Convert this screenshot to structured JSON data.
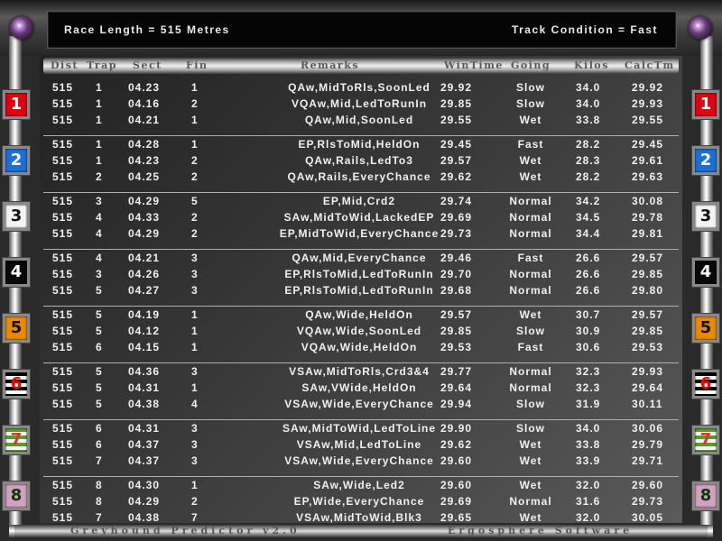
{
  "info": {
    "race_length": "Race Length = 515 Metres",
    "track_condition": "Track Condition = Fast"
  },
  "headers": {
    "dist": "Dist",
    "trap": "Trap",
    "sect": "Sect",
    "fin": "Fin",
    "remarks": "Remarks",
    "wintime": "WinTime",
    "going": "Going",
    "kilos": "Kilos",
    "calctm": "CalcTm"
  },
  "traps": [
    {
      "number": "1",
      "color": "#e00010"
    },
    {
      "number": "2",
      "color": "#1a70d8"
    },
    {
      "number": "3",
      "color": "#f4f4f4"
    },
    {
      "number": "4",
      "color": "#080808"
    },
    {
      "number": "5",
      "color": "#e88a00"
    },
    {
      "number": "6",
      "color": "#000000"
    },
    {
      "number": "7",
      "color": "#5a9a30"
    },
    {
      "number": "8",
      "color": "#d4a0c0"
    }
  ],
  "groups": [
    {
      "rows": [
        {
          "dist": "515",
          "trap": "1",
          "sect": "04.23",
          "fin": "1",
          "remarks": "QAw,MidToRls,SoonLed",
          "wintime": "29.92",
          "going": "Slow",
          "kilos": "34.0",
          "calctm": "29.92"
        },
        {
          "dist": "515",
          "trap": "1",
          "sect": "04.16",
          "fin": "2",
          "remarks": "VQAw,Mid,LedToRunIn",
          "wintime": "29.85",
          "going": "Slow",
          "kilos": "34.0",
          "calctm": "29.93"
        },
        {
          "dist": "515",
          "trap": "1",
          "sect": "04.21",
          "fin": "1",
          "remarks": "QAw,Mid,SoonLed",
          "wintime": "29.55",
          "going": "Wet",
          "kilos": "33.8",
          "calctm": "29.55"
        }
      ]
    },
    {
      "rows": [
        {
          "dist": "515",
          "trap": "1",
          "sect": "04.28",
          "fin": "1",
          "remarks": "EP,RlsToMid,HeldOn",
          "wintime": "29.45",
          "going": "Fast",
          "kilos": "28.2",
          "calctm": "29.45"
        },
        {
          "dist": "515",
          "trap": "1",
          "sect": "04.23",
          "fin": "2",
          "remarks": "QAw,Rails,LedTo3",
          "wintime": "29.57",
          "going": "Wet",
          "kilos": "28.3",
          "calctm": "29.61"
        },
        {
          "dist": "515",
          "trap": "2",
          "sect": "04.25",
          "fin": "2",
          "remarks": "QAw,Rails,EveryChance",
          "wintime": "29.62",
          "going": "Wet",
          "kilos": "28.2",
          "calctm": "29.63"
        }
      ]
    },
    {
      "rows": [
        {
          "dist": "515",
          "trap": "3",
          "sect": "04.29",
          "fin": "5",
          "remarks": "EP,Mid,Crd2",
          "wintime": "29.74",
          "going": "Normal",
          "kilos": "34.2",
          "calctm": "30.08"
        },
        {
          "dist": "515",
          "trap": "4",
          "sect": "04.33",
          "fin": "2",
          "remarks": "SAw,MidToWid,LackedEP",
          "wintime": "29.69",
          "going": "Normal",
          "kilos": "34.5",
          "calctm": "29.78"
        },
        {
          "dist": "515",
          "trap": "4",
          "sect": "04.29",
          "fin": "2",
          "remarks": "EP,MidToWid,EveryChance",
          "wintime": "29.73",
          "going": "Normal",
          "kilos": "34.4",
          "calctm": "29.81"
        }
      ]
    },
    {
      "rows": [
        {
          "dist": "515",
          "trap": "4",
          "sect": "04.21",
          "fin": "3",
          "remarks": "QAw,Mid,EveryChance",
          "wintime": "29.46",
          "going": "Fast",
          "kilos": "26.6",
          "calctm": "29.57"
        },
        {
          "dist": "515",
          "trap": "3",
          "sect": "04.26",
          "fin": "3",
          "remarks": "EP,RlsToMid,LedToRunIn",
          "wintime": "29.70",
          "going": "Normal",
          "kilos": "26.6",
          "calctm": "29.85"
        },
        {
          "dist": "515",
          "trap": "5",
          "sect": "04.27",
          "fin": "3",
          "remarks": "EP,RlsToMid,LedToRunIn",
          "wintime": "29.68",
          "going": "Normal",
          "kilos": "26.6",
          "calctm": "29.80"
        }
      ]
    },
    {
      "rows": [
        {
          "dist": "515",
          "trap": "5",
          "sect": "04.19",
          "fin": "1",
          "remarks": "QAw,Wide,HeldOn",
          "wintime": "29.57",
          "going": "Wet",
          "kilos": "30.7",
          "calctm": "29.57"
        },
        {
          "dist": "515",
          "trap": "5",
          "sect": "04.12",
          "fin": "1",
          "remarks": "VQAw,Wide,SoonLed",
          "wintime": "29.85",
          "going": "Slow",
          "kilos": "30.9",
          "calctm": "29.85"
        },
        {
          "dist": "515",
          "trap": "6",
          "sect": "04.15",
          "fin": "1",
          "remarks": "VQAw,Wide,HeldOn",
          "wintime": "29.53",
          "going": "Fast",
          "kilos": "30.6",
          "calctm": "29.53"
        }
      ]
    },
    {
      "rows": [
        {
          "dist": "515",
          "trap": "5",
          "sect": "04.36",
          "fin": "3",
          "remarks": "VSAw,MidToRls,Crd3&4",
          "wintime": "29.77",
          "going": "Normal",
          "kilos": "32.3",
          "calctm": "29.93"
        },
        {
          "dist": "515",
          "trap": "5",
          "sect": "04.31",
          "fin": "1",
          "remarks": "SAw,VWide,HeldOn",
          "wintime": "29.64",
          "going": "Normal",
          "kilos": "32.3",
          "calctm": "29.64"
        },
        {
          "dist": "515",
          "trap": "5",
          "sect": "04.38",
          "fin": "4",
          "remarks": "VSAw,Wide,EveryChance",
          "wintime": "29.94",
          "going": "Slow",
          "kilos": "31.9",
          "calctm": "30.11"
        }
      ]
    },
    {
      "rows": [
        {
          "dist": "515",
          "trap": "6",
          "sect": "04.31",
          "fin": "3",
          "remarks": "SAw,MidToWid,LedToLine",
          "wintime": "29.90",
          "going": "Slow",
          "kilos": "34.0",
          "calctm": "30.06"
        },
        {
          "dist": "515",
          "trap": "6",
          "sect": "04.37",
          "fin": "3",
          "remarks": "VSAw,Mid,LedToLine",
          "wintime": "29.62",
          "going": "Wet",
          "kilos": "33.8",
          "calctm": "29.79"
        },
        {
          "dist": "515",
          "trap": "7",
          "sect": "04.37",
          "fin": "3",
          "remarks": "VSAw,Wide,EveryChance",
          "wintime": "29.60",
          "going": "Wet",
          "kilos": "33.9",
          "calctm": "29.71"
        }
      ]
    },
    {
      "rows": [
        {
          "dist": "515",
          "trap": "8",
          "sect": "04.30",
          "fin": "1",
          "remarks": "SAw,Wide,Led2",
          "wintime": "29.60",
          "going": "Wet",
          "kilos": "32.0",
          "calctm": "29.60"
        },
        {
          "dist": "515",
          "trap": "8",
          "sect": "04.29",
          "fin": "2",
          "remarks": "EP,Wide,EveryChance",
          "wintime": "29.69",
          "going": "Normal",
          "kilos": "31.6",
          "calctm": "29.73"
        },
        {
          "dist": "515",
          "trap": "7",
          "sect": "04.38",
          "fin": "7",
          "remarks": "VSAw,MidToWid,Blk3",
          "wintime": "29.65",
          "going": "Wet",
          "kilos": "32.0",
          "calctm": "30.05"
        }
      ]
    }
  ],
  "footer": {
    "app_name": "Greyhound Predictor v2.0",
    "company": "Ergosphere Software"
  }
}
